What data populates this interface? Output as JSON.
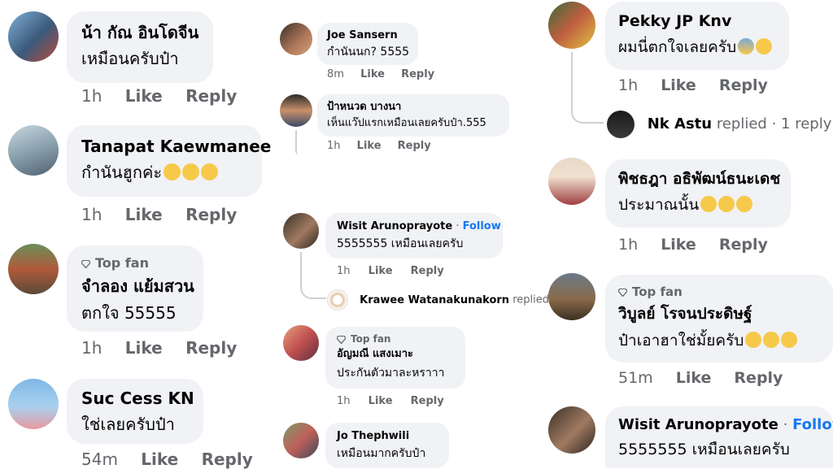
{
  "columns": {
    "left": [
      {
        "name": "น้า กัณ อินโดจีน",
        "text": "เหมือนครับป๋า",
        "time": "1h",
        "like": "Like",
        "reply": "Reply"
      },
      {
        "name": "Tanapat Kaewmanee",
        "text": "กำนันฮูกค่ะ",
        "emoji": [
          "😂",
          "😂",
          "😂"
        ],
        "time": "1h",
        "like": "Like",
        "reply": "Reply"
      },
      {
        "badge": "Top fan",
        "name": "จำลอง แย้มสวน",
        "text": "ตกใจ 55555",
        "time": "1h",
        "like": "Like",
        "reply": "Reply"
      },
      {
        "name": "Suc Cess KN",
        "text": "ใช่เลยครับป๋า",
        "time": "54m",
        "like": "Like",
        "reply": "Reply"
      }
    ],
    "middle": [
      {
        "name": "Joe Sansern",
        "text": "กำนันนก? 5555",
        "time": "8m",
        "like": "Like",
        "reply": "Reply"
      },
      {
        "name": "ป้าหนวด บางนา",
        "text": "เห็นแว๊ปแรกเหมือนเลยครับป๋า.555",
        "time": "1h",
        "like": "Like",
        "reply": "Reply"
      },
      {
        "name": "Wisit Arunoprayote",
        "follow": "Follow",
        "text": "5555555 เหมือนเลยครับ",
        "time": "1h",
        "like": "Like",
        "reply": "Reply",
        "replied": {
          "name": "Krawee Watanakunakorn",
          "label": "replied ·"
        }
      },
      {
        "badge": "Top fan",
        "name": "อัญมณี แสงเมาะ",
        "text": "ประกันตัวมาละหราาา",
        "time": "1h",
        "like": "Like",
        "reply": "Reply"
      },
      {
        "name": "Jo Thephwili",
        "text": "เหมือนมากครับป๋า"
      }
    ],
    "right": [
      {
        "name": "Pekky JP Knv",
        "text": "ผมนี่ตกใจเลยครับ",
        "emoji": [
          "😱",
          "😅"
        ],
        "time": "1h",
        "like": "Like",
        "reply": "Reply",
        "replied": {
          "name": "Nk Astu",
          "label": "replied · 1 reply"
        }
      },
      {
        "name": "พิชธฎา อธิพัฒน์ธนะเดช",
        "text": "ประมาณนั้น",
        "emoji": [
          "🤣",
          "🤣",
          "🤣"
        ],
        "time": "1h",
        "like": "Like",
        "reply": "Reply"
      },
      {
        "badge": "Top fan",
        "name": "วิบูลย์ โรจนประดิษฐ์",
        "text": "ป๋าเอาฮาใช่มั้ยครับ",
        "emoji": [
          "😆",
          "😁",
          "😅"
        ],
        "time": "51m",
        "like": "Like",
        "reply": "Reply"
      },
      {
        "name": "Wisit Arunoprayote",
        "follow": "Follow",
        "text": "5555555 เหมือนเลยครับ"
      }
    ]
  },
  "colors": {
    "bubble": "#f0f2f5",
    "meta": "#65676b",
    "link": "#1877f2"
  }
}
